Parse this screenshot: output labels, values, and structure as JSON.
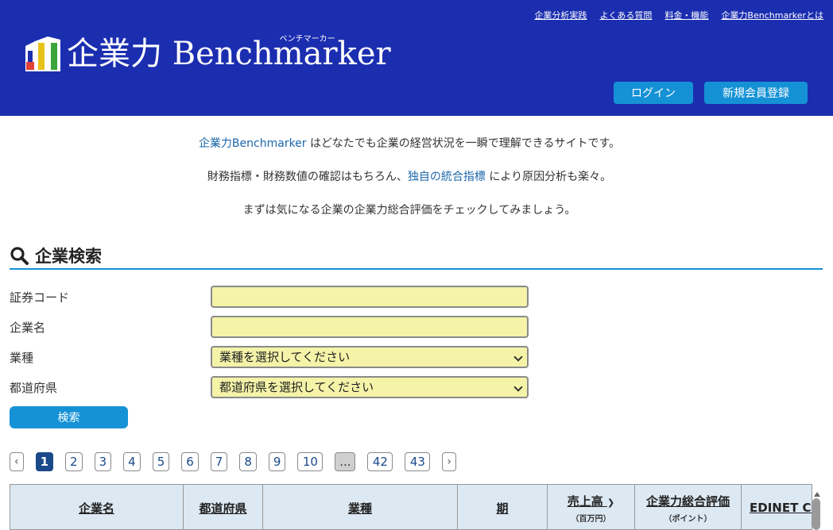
{
  "header": {
    "top_links": [
      "企業分析実践",
      "よくある質問",
      "料金・機能",
      "企業力Benchmarkerとは"
    ],
    "logo_text": "企業力 Benchmarker",
    "logo_ruby": "ベンチマーカー",
    "login_label": "ログイン",
    "register_label": "新規会員登録",
    "bg_color": "#1b2eb0",
    "button_color": "#1592d6"
  },
  "intro": {
    "line1_link": "企業力Benchmarker",
    "line1_rest": " はどなたでも企業の経営状況を一瞬で理解できるサイトです。",
    "line2_pre": "財務指標・財務数値の確認はもちろん、",
    "line2_link": "独自の統合指標",
    "line2_post": " により原因分析も楽々。",
    "line3": "まずは気になる企業の企業力総合評価をチェックしてみましょう。"
  },
  "search": {
    "title": "企業検索",
    "icon": "search-icon",
    "fields": {
      "code_label": "証券コード",
      "code_value": "",
      "name_label": "企業名",
      "name_value": "",
      "industry_label": "業種",
      "industry_value": "業種を選択してください",
      "prefecture_label": "都道府県",
      "prefecture_value": "都道府県を選択してください"
    },
    "submit_label": "検索"
  },
  "pagination": {
    "prev": "‹",
    "pages": [
      "1",
      "2",
      "3",
      "4",
      "5",
      "6",
      "7",
      "8",
      "9",
      "10"
    ],
    "ellipsis": "...",
    "last_pages": [
      "42",
      "43"
    ],
    "next": "›",
    "current": "1"
  },
  "table": {
    "columns": [
      {
        "title": "企業名",
        "sub": ""
      },
      {
        "title": "都道府県",
        "sub": ""
      },
      {
        "title": "業種",
        "sub": ""
      },
      {
        "title": "期",
        "sub": ""
      },
      {
        "title": "売上高",
        "sub": "（百万円）"
      },
      {
        "title": "企業力総合評価",
        "sub": "（ポイント）"
      },
      {
        "title": "EDINET CO",
        "sub": ""
      }
    ]
  }
}
